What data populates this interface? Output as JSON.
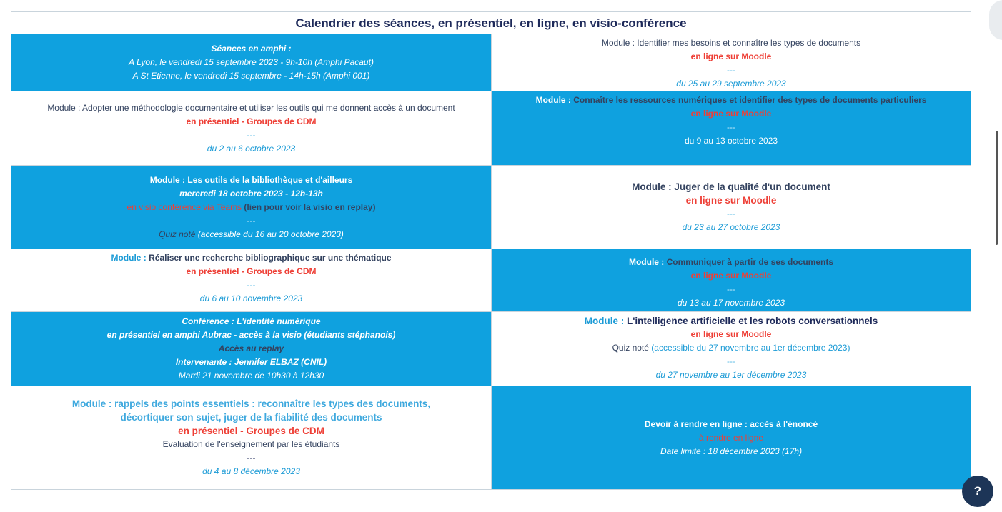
{
  "title": "Calendrier des séances, en présentiel, en ligne, en visio-conférence",
  "cells": {
    "r1l": {
      "title": "Séances en amphi :",
      "line1": "A Lyon, le vendredi 15 septembre 2023 - 9h-10h (Amphi Pacaut)",
      "line2": "A St Etienne, le vendredi 15 septembre - 14h-15h (Amphi 001)"
    },
    "r1r": {
      "module": "Module : Identifier mes besoins et connaître les types de documents",
      "mode": "en ligne sur Moodle",
      "sep": "---",
      "date": "du 25 au 29 septembre 2023"
    },
    "r2l": {
      "module": "Module : Adopter une méthodologie documentaire et utiliser les outils qui me donnent accès à un document",
      "mode": "en présentiel - Groupes de CDM",
      "sep": "---",
      "date": "du 2 au 6 octobre 2023"
    },
    "r2r": {
      "prefix": "Module :",
      "title": "Connaître les ressources numériques et identifier des types de documents particuliers",
      "mode": "en ligne sur Moodle",
      "sep": "---",
      "date": "du 9 au 13 octobre 2023"
    },
    "r3l": {
      "module": "Module : Les outils de la bibliothèque et d'ailleurs",
      "when": "mercredi 18 octobre 2023 - 12h-13h",
      "visio": "en visio conférence via Teams",
      "replay": "(lien pour voir la visio en replay)",
      "sep": "---",
      "quiz": "Quiz noté",
      "quiz_note": "(accessible du 16 au 20 octobre 2023)"
    },
    "r3r": {
      "module": "Module : Juger de la qualité d'un document",
      "mode": "en ligne sur Moodle",
      "sep": "---",
      "date": "du 23 au 27 octobre 2023"
    },
    "r4l": {
      "prefix": "Module :",
      "title": "Réaliser une recherche bibliographique sur une thématique",
      "mode": "en présentiel - Groupes de CDM",
      "sep": "---",
      "date": "du 6 au 10 novembre 2023"
    },
    "r4r": {
      "prefix": "Module :",
      "title": "Communiquer à partir de ses documents",
      "mode": "en ligne sur Moodle",
      "sep": "---",
      "date": "du 13 au 17 novembre 2023"
    },
    "r5l": {
      "title": "Conférence : L'identité numérique",
      "where": "en présentiel en amphi Aubrac - accès à la visio (étudiants stéphanois)",
      "replay": "Accès au replay",
      "speaker": "Intervenante : Jennifer ELBAZ (CNIL)",
      "date": "Mardi 21 novembre de 10h30 à 12h30"
    },
    "r5r": {
      "prefix": "Module :",
      "title": "L'intelligence artificielle et les robots conversationnels",
      "mode": "en ligne sur Moodle",
      "quiz": "Quiz noté",
      "quiz_note": "(accessible du 27 novembre au 1er décembre 2023)",
      "sep": "---",
      "date": "du 27 novembre au 1er décembre 2023"
    },
    "r6l": {
      "line1": "Module : rappels des points essentiels : reconnaître les types des documents,",
      "line2": "décortiquer son sujet, juger de la fiabilité des documents",
      "mode": "en présentiel - Groupes de CDM",
      "eval": "Evaluation de l'enseignement par les étudiants",
      "sep": "---",
      "date": "du 4 au 8 décembre 2023"
    },
    "r6r": {
      "title": "Devoir  à rendre en ligne : accès à l'énoncé",
      "mode": "à rendre en ligne",
      "deadline": "Date limite : 18 décembre 2023 (17h)"
    }
  },
  "help": {
    "label": "?"
  },
  "colors": {
    "cell_blue": "#0fa1df",
    "accent_red": "#ee3f36",
    "dark_text": "#33425f",
    "navy_title": "#1e2a5a",
    "cyan_text": "#1c9bd6",
    "help_button": "#1d3557"
  }
}
